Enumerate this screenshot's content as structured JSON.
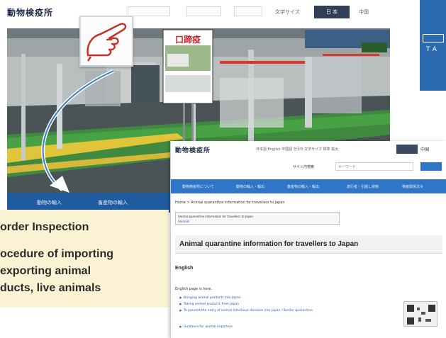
{
  "back_site": {
    "logo": "動物検疫所",
    "header_button": "日 本",
    "header_link_1": "文字サイズ",
    "header_link_2": "中国",
    "photo_poster_text": "口蹄疫",
    "side_text": "TA",
    "nav_items": [
      "動物の輸入",
      "畜産物の輸入"
    ]
  },
  "caption": {
    "title": "order Inspection",
    "lines": [
      "ocedure of importing",
      "exporting animal",
      "ducts, live animals"
    ]
  },
  "front_site": {
    "logo": "動物検疫所",
    "header_text": "日本語 English 中国語 한국어 文字サイズ 標準 拡大",
    "header_button": "日",
    "header_link": "中国",
    "search_label": "サイト内検索",
    "search_placeholder": "キーワード",
    "nav_items": [
      "動物検疫所について",
      "動物の輸入・輸出",
      "畜産物の輸入・輸出",
      "旅行者・引越し荷物",
      "検疫関係法令"
    ],
    "breadcrumb": "Home > Animal quarantine information for travellers to Japan",
    "notice_text": "Animal quarantine information for travellers to Japan",
    "notice_link": "Animals",
    "heading": "Animal quarantine information for travellers to Japan",
    "english_label": "English",
    "english_page_text": "English page is here.",
    "list_items": [
      "Bringing animal products into Japan",
      "Taking animal products from Japan",
      "To prevent the entry of animal infectious diseases into Japan / Border quarantine",
      "Guidance for animal importers"
    ]
  },
  "colors": {
    "nav_blue": "#1f5b9e",
    "front_nav_blue": "#2f76c8",
    "caption_bg": "#fbf2d3",
    "hand_red": "#c7322b"
  }
}
